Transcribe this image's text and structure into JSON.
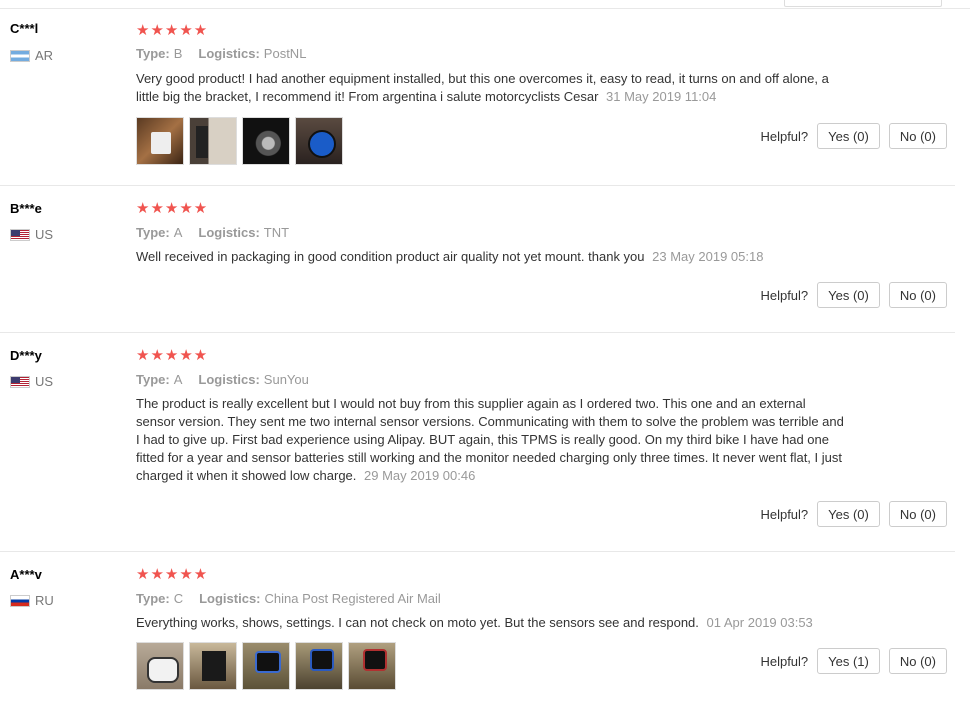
{
  "helpful_label": "Helpful?",
  "reviews": [
    {
      "user": "C***l",
      "country": "AR",
      "flag": "flag-ar",
      "stars": "★★★★★",
      "type_label": "Type:",
      "type_value": "B",
      "logistics_label": "Logistics:",
      "logistics_value": "PostNL",
      "text": "Very good product! I had another equipment installed, but this one overcomes it, easy to read, it turns on and off alone, a little big the bracket, I recommend it! From argentina i salute motorcyclists Cesar",
      "date": "31 May 2019 11:04",
      "yes": "Yes (0)",
      "no": "No (0)"
    },
    {
      "user": "B***e",
      "country": "US",
      "flag": "flag-us",
      "stars": "★★★★★",
      "type_label": "Type:",
      "type_value": "A",
      "logistics_label": "Logistics:",
      "logistics_value": "TNT",
      "text": "Well received in packaging in good condition product air quality not yet mount. thank you",
      "date": "23 May 2019 05:18",
      "yes": "Yes (0)",
      "no": "No (0)"
    },
    {
      "user": "D***y",
      "country": "US",
      "flag": "flag-us",
      "stars": "★★★★★",
      "type_label": "Type:",
      "type_value": "A",
      "logistics_label": "Logistics:",
      "logistics_value": "SunYou",
      "text": "The product is really excellent but I would not buy from this supplier again as I ordered two. This one and an external sensor version. They sent me two internal sensor versions. Communicating with them to solve the problem was terrible and I had to give up. First bad experience using Alipay. BUT again, this TPMS is really good. On my third bike I have had one fitted for a year and sensor batteries still working and the monitor needed charging only three times. It never went flat, I just charged it when it showed low charge.",
      "date": "29 May 2019 00:46",
      "yes": "Yes (0)",
      "no": "No (0)"
    },
    {
      "user": "A***v",
      "country": "RU",
      "flag": "flag-ru",
      "stars": "★★★★★",
      "type_label": "Type:",
      "type_value": "C",
      "logistics_label": "Logistics:",
      "logistics_value": "China Post Registered Air Mail",
      "text": "Everything works, shows, settings. I can not check on moto yet. But the sensors see and respond.",
      "date": "01 Apr 2019 03:53",
      "yes": "Yes (1)",
      "no": "No (0)"
    }
  ]
}
